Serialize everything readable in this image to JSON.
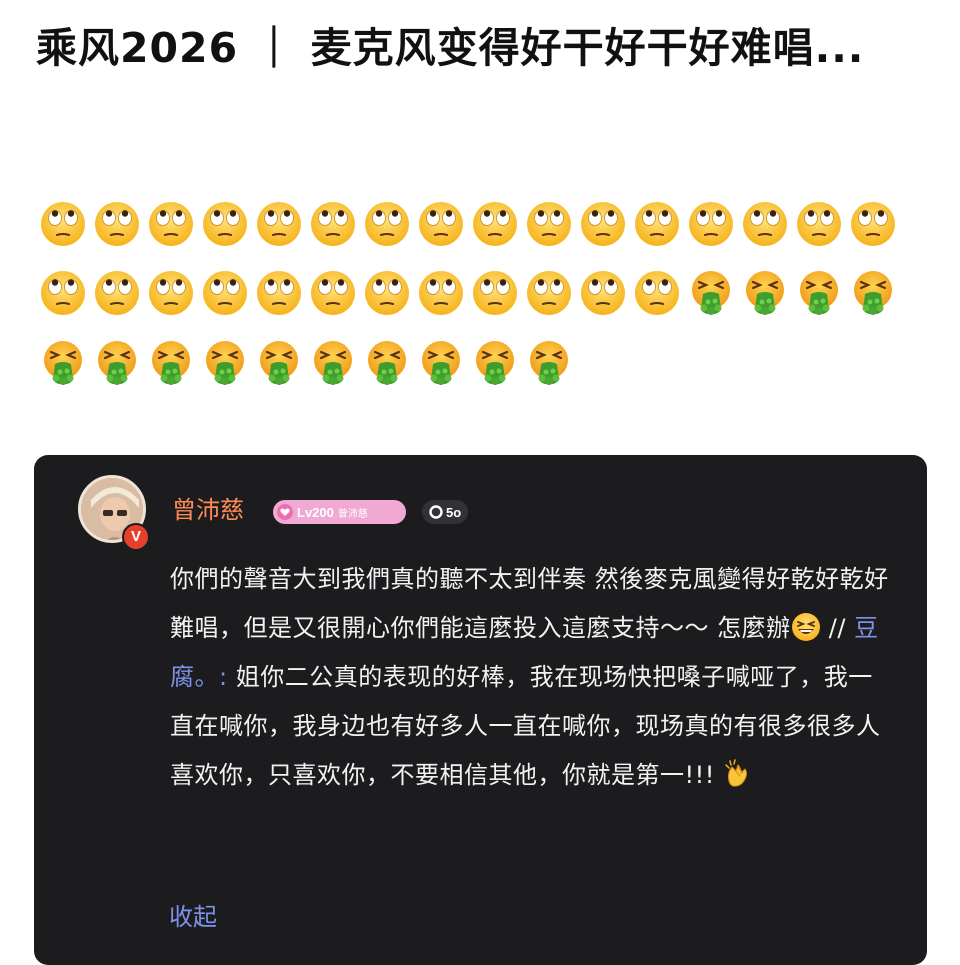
{
  "post": {
    "title": "乘风2026 ｜ 麦克风变得好干好干好难唱...",
    "emoji_rows": [
      [
        "eye-roll",
        "eye-roll",
        "eye-roll",
        "eye-roll",
        "eye-roll",
        "eye-roll",
        "eye-roll",
        "eye-roll",
        "eye-roll",
        "eye-roll",
        "eye-roll",
        "eye-roll",
        "eye-roll",
        "eye-roll",
        "eye-roll",
        "eye-roll"
      ],
      [
        "eye-roll",
        "eye-roll",
        "eye-roll",
        "eye-roll",
        "eye-roll",
        "eye-roll",
        "eye-roll",
        "eye-roll",
        "eye-roll",
        "eye-roll",
        "eye-roll",
        "eye-roll",
        "vomit",
        "vomit",
        "vomit",
        "vomit"
      ],
      [
        "vomit",
        "vomit",
        "vomit",
        "vomit",
        "vomit",
        "vomit",
        "vomit",
        "vomit",
        "vomit",
        "vomit"
      ]
    ]
  },
  "comment_card": {
    "username": "曾沛慈",
    "verified_badge": "V",
    "level": "Lv200",
    "level_name": "曾沛慈",
    "fans_label": "5o",
    "text_part1": "你們的聲音大到我們真的聽不太到伴奏 然後麥克風變得好乾好乾好難唱，但是又很開心你們能這麼投入這麼支持～～ 怎麼辦",
    "separator": " // ",
    "mention": "豆腐。:",
    "text_part2": " 姐你二公真的表现的好棒，我在现场快把嗓子喊哑了，我一直在喊你，我身边也有好多人一直在喊你，现场真的有很多很多人喜欢你，只喜欢你，不要相信其他，你就是第一!!! ",
    "collapse_label": "收起",
    "icons": [
      "avatar",
      "heart-icon",
      "fans-icon",
      "laughing-emoji",
      "clap-emoji"
    ],
    "colors": {
      "username": "#ff8a55",
      "link": "#7e93e8",
      "card_bg": "#1c1b1e",
      "badge_pink": "#f0a9d2"
    }
  }
}
